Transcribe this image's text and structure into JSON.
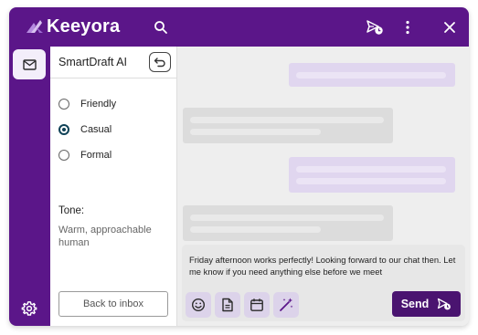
{
  "app": {
    "name": "Keeyora"
  },
  "header": {
    "icons": [
      "search-icon",
      "send-scheduled-icon",
      "more-vertical-icon",
      "close-icon"
    ]
  },
  "rail": {
    "icons": [
      "mail-icon",
      "gear-icon"
    ]
  },
  "panel": {
    "title": "SmartDraft AI",
    "options": [
      {
        "label": "Friendly",
        "selected": false
      },
      {
        "label": "Casual",
        "selected": true
      },
      {
        "label": "Formal",
        "selected": false
      }
    ],
    "tone_heading": "Tone:",
    "tone_value": "Warm, approachable human",
    "back_label": "Back to inbox"
  },
  "compose": {
    "text": "Friday afternoon works perfectly! Looking forward to our chat then. Let me know if you need anything else before we meet",
    "tools": [
      "emoji-icon",
      "document-icon",
      "calendar-icon",
      "magic-wand-icon"
    ],
    "send_label": "Send"
  },
  "colors": {
    "brand": "#5b1689",
    "send": "#4a1470",
    "selected_radio": "#0f4257",
    "outgoing_bubble": "#e0d6ef",
    "incoming_bubble": "#dcdcdc"
  }
}
